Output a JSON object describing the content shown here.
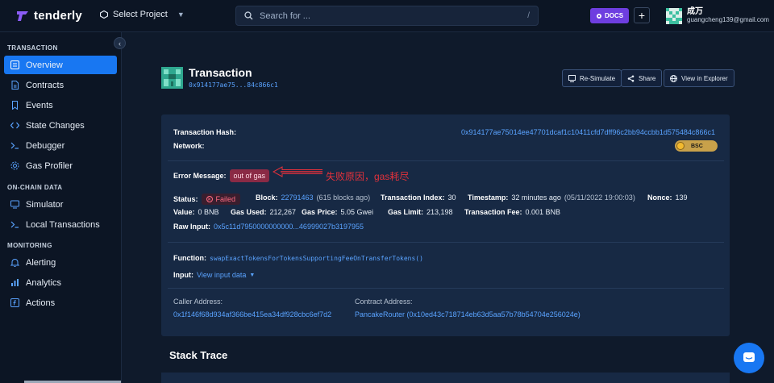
{
  "topbar": {
    "brand": "tenderly",
    "project_label": "Select Project",
    "search_placeholder": "Search for ...",
    "search_shortcut": "/",
    "docs_label": "DOCS",
    "plus_label": "+",
    "user_name": "成万",
    "user_email": "guangcheng139@gmail.com"
  },
  "sidebar": {
    "sections": [
      {
        "title": "TRANSACTION",
        "items": [
          "Overview",
          "Contracts",
          "Events",
          "State Changes",
          "Debugger",
          "Gas Profiler"
        ]
      },
      {
        "title": "ON-CHAIN DATA",
        "items": [
          "Simulator",
          "Local Transactions"
        ]
      },
      {
        "title": "MONITORING",
        "items": [
          "Alerting",
          "Analytics",
          "Actions"
        ]
      }
    ],
    "collapse_icon": "‹"
  },
  "header": {
    "title": "Transaction",
    "short_hash": "0x914177ae75...84c866c1",
    "buttons": {
      "resimulate": "Re-Simulate",
      "share": "Share",
      "explorer": "View in Explorer"
    }
  },
  "details": {
    "hash_label": "Transaction Hash:",
    "hash_value": "0x914177ae75014ee47701dcaf1c10411cfd7dff96c2bb94ccbb1d575484c866c1",
    "network_label": "Network:",
    "network_value": "BSC",
    "error_label": "Error Message:",
    "error_value": "out of gas",
    "annotation": "失败原因，gas耗尽",
    "status_label": "Status:",
    "status_value": "Failed",
    "block_label": "Block:",
    "block_value": "22791463",
    "block_note": "(615 blocks ago)",
    "tx_index_label": "Transaction Index:",
    "tx_index_value": "30",
    "timestamp_label": "Timestamp:",
    "timestamp_value": "32 minutes ago",
    "timestamp_note": "(05/11/2022 19:00:03)",
    "nonce_label": "Nonce:",
    "nonce_value": "139",
    "value_label": "Value:",
    "value_value": "0 BNB",
    "gas_used_label": "Gas Used:",
    "gas_used_value": "212,267",
    "gas_price_label": "Gas Price:",
    "gas_price_value": "5.05 Gwei",
    "gas_limit_label": "Gas Limit:",
    "gas_limit_value": "213,198",
    "fee_label": "Transaction Fee:",
    "fee_value": "0.001 BNB",
    "raw_input_label": "Raw Input:",
    "raw_input_value": "0x5c11d7950000000000...46999027b3197955",
    "function_label": "Function:",
    "function_value": "swapExactTokensForTokensSupportingFeeOnTransferTokens()",
    "input_label": "Input:",
    "input_value": "View input data",
    "caller_label": "Caller Address:",
    "caller_value": "0x1f146f68d934af366be415ea34df928cbc6ef7d2",
    "contract_label": "Contract Address:",
    "contract_value": "PancakeRouter (0x10ed43c718714eb63d5aa57b78b54704e256024e)"
  },
  "stack_trace": {
    "title": "Stack Trace"
  },
  "colors": {
    "accent": "#1877f2",
    "link": "#5aa3ff",
    "background": "#0f1a2b",
    "card": "#172944",
    "error": "#8a2a45",
    "annotation": "#e2313b",
    "docs": "#6e3ee0"
  }
}
